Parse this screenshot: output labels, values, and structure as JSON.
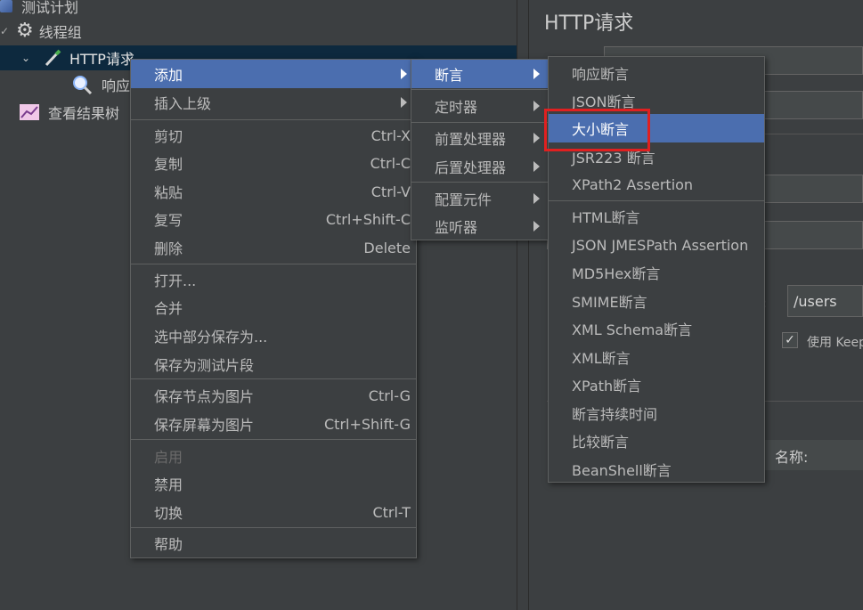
{
  "tree": {
    "items": [
      {
        "label": "测试计划"
      },
      {
        "label": "线程组"
      },
      {
        "label": "HTTP请求"
      },
      {
        "label": "响应"
      },
      {
        "label": "查看结果树"
      }
    ]
  },
  "right_panel": {
    "title": "HTTP请求",
    "path_value": "/users",
    "keepalive_label": "使用 Keep",
    "name_label": "名称:"
  },
  "context_menu": {
    "items": [
      {
        "label": "添加",
        "shortcut": ""
      },
      {
        "label": "插入上级",
        "shortcut": ""
      },
      {
        "label": "剪切",
        "shortcut": "Ctrl-X"
      },
      {
        "label": "复制",
        "shortcut": "Ctrl-C"
      },
      {
        "label": "粘贴",
        "shortcut": "Ctrl-V"
      },
      {
        "label": "复写",
        "shortcut": "Ctrl+Shift-C"
      },
      {
        "label": "删除",
        "shortcut": "Delete"
      },
      {
        "label": "打开...",
        "shortcut": ""
      },
      {
        "label": "合并",
        "shortcut": ""
      },
      {
        "label": "选中部分保存为...",
        "shortcut": ""
      },
      {
        "label": "保存为测试片段",
        "shortcut": ""
      },
      {
        "label": "保存节点为图片",
        "shortcut": "Ctrl-G"
      },
      {
        "label": "保存屏幕为图片",
        "shortcut": "Ctrl+Shift-G"
      },
      {
        "label": "启用",
        "shortcut": ""
      },
      {
        "label": "禁用",
        "shortcut": ""
      },
      {
        "label": "切换",
        "shortcut": "Ctrl-T"
      },
      {
        "label": "帮助",
        "shortcut": ""
      }
    ]
  },
  "add_submenu": {
    "items": [
      {
        "label": "断言"
      },
      {
        "label": "定时器"
      },
      {
        "label": "前置处理器"
      },
      {
        "label": "后置处理器"
      },
      {
        "label": "配置元件"
      },
      {
        "label": "监听器"
      }
    ]
  },
  "assertion_submenu": {
    "items": [
      {
        "label": "响应断言"
      },
      {
        "label": "JSON断言"
      },
      {
        "label": "大小断言"
      },
      {
        "label": "JSR223 断言"
      },
      {
        "label": "XPath2 Assertion"
      },
      {
        "label": "HTML断言"
      },
      {
        "label": "JSON JMESPath Assertion"
      },
      {
        "label": "MD5Hex断言"
      },
      {
        "label": "SMIME断言"
      },
      {
        "label": "XML Schema断言"
      },
      {
        "label": "XML断言"
      },
      {
        "label": "XPath断言"
      },
      {
        "label": "断言持续时间"
      },
      {
        "label": "比较断言"
      },
      {
        "label": "BeanShell断言"
      }
    ]
  },
  "colors": {
    "background": "#3c3f41",
    "highlight": "#4b6eaf",
    "annotation_box": "#e02020"
  }
}
